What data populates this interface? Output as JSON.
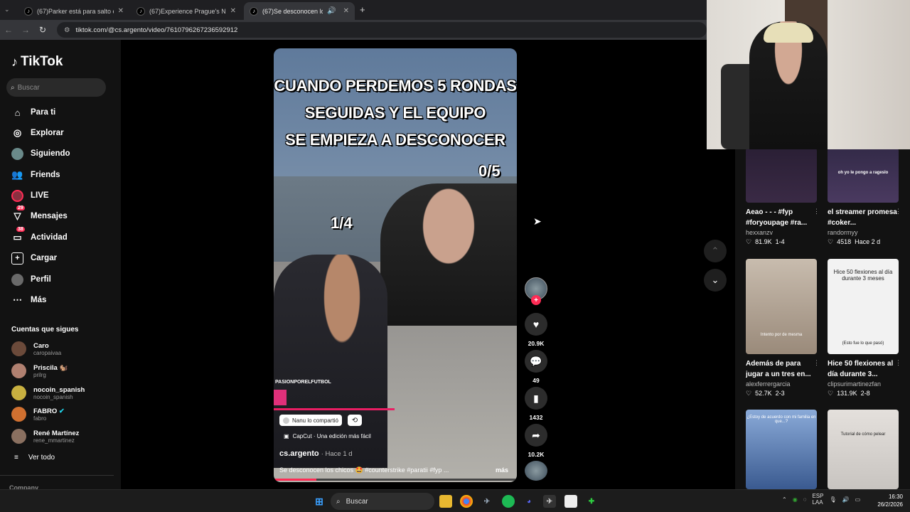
{
  "browser": {
    "tabs": [
      {
        "title": "(67)Parker está para salto en la",
        "active": false
      },
      {
        "title": "(67)Experience Prague's Nightl",
        "active": false
      },
      {
        "title": "(67)Se desconocen los chic",
        "active": true
      }
    ],
    "url": "tiktok.com/@cs.argento/video/7610796267236592912"
  },
  "sidebar": {
    "logo": "TikTok",
    "search_placeholder": "Buscar",
    "nav": [
      {
        "label": "Para ti",
        "icon": "home-icon"
      },
      {
        "label": "Explorar",
        "icon": "compass-icon"
      },
      {
        "label": "Siguiendo",
        "icon": "following-avatar-icon"
      },
      {
        "label": "Friends",
        "icon": "friends-icon"
      },
      {
        "label": "LIVE",
        "icon": "live-icon"
      },
      {
        "label": "Mensajes",
        "icon": "messages-icon",
        "badge": "29"
      },
      {
        "label": "Actividad",
        "icon": "activity-icon",
        "badge": "38"
      },
      {
        "label": "Cargar",
        "icon": "upload-icon"
      },
      {
        "label": "Perfil",
        "icon": "profile-avatar-icon"
      },
      {
        "label": "Más",
        "icon": "more-icon"
      }
    ],
    "following_header": "Cuentas que sigues",
    "accounts": [
      {
        "name": "Caro",
        "handle": "caropaivaa",
        "color": "#6b4a3a"
      },
      {
        "name": "Priscila 🐿️",
        "handle": "prilrg",
        "color": "#b08070"
      },
      {
        "name": "nocoin_spanish",
        "handle": "nocoin_spanish",
        "color": "#c8b040"
      },
      {
        "name": "FABRO",
        "handle": "fabro",
        "verified": true,
        "color": "#d07030"
      },
      {
        "name": "René Martínez",
        "handle": "rene_mmartinez",
        "color": "#8a7060"
      }
    ],
    "see_all": "Ver todo",
    "company": "Company"
  },
  "video": {
    "overlay_lines": [
      "CUANDO PERDEMOS 5 RONDAS",
      "SEGUIDAS Y EL EQUIPO",
      "SE EMPIEZA A DESCONOCER"
    ],
    "score_top": "0/5",
    "score_mid": "1/4",
    "watermark": "PASIONPORELFUTBOL",
    "shared_chip": "Nanu lo compartió",
    "capcut": "CapCut · Una edición más fácil",
    "author": "cs.argento",
    "posted": "· Hace 1 d",
    "description": "Se desconocen los chicos 🤩 #counterstrike #paratii #fyp ...",
    "more": "más"
  },
  "actions": {
    "likes": "20.9K",
    "comments": "49",
    "saves": "1432",
    "shares": "10.2K"
  },
  "recommended": [
    {
      "title": "Aeao - - - #fyp #foryoupage #ra...",
      "user": "hexxanzv",
      "likes": "81.9K",
      "meta": "1-4",
      "thumb_color": "#3a2a45"
    },
    {
      "title": "el streamer promesa #coker...",
      "user": "randormyy",
      "likes": "4518",
      "meta": "Hace 2 d",
      "thumb_color": "#4a3a60",
      "thumb_text": "oh yo le pongo a rageslo"
    },
    {
      "title": "Además de para jugar a un tres en...",
      "user": "alexferrergarcia",
      "likes": "52.7K",
      "meta": "2-3",
      "thumb_color": "#b8a898",
      "thumb_text": "Intento por de mesma"
    },
    {
      "title": "Hice 50 flexiones al día durante 3...",
      "user": "clipsurimartinezfan",
      "likes": "131.9K",
      "meta": "2-8",
      "thumb_color": "#eeeeee",
      "thumb_text": "Hice 50 flexiones al día durante 3 meses",
      "thumb_text2": "(Esto fue lo que pasó)"
    },
    {
      "title": "",
      "user": "",
      "likes": "",
      "meta": "",
      "thumb_color": "#5a7ab0",
      "thumb_text": "¿Estoy de acuerdo con mi familia en que...?"
    },
    {
      "title": "",
      "user": "",
      "likes": "",
      "meta": "",
      "thumb_color": "#d8d4d0",
      "thumb_text": "Tutorial de cómo pelear"
    }
  ],
  "taskbar": {
    "search": "Buscar",
    "lang1": "ESP",
    "lang2": "LAA",
    "time": "16:30",
    "date": "26/2/2026"
  }
}
